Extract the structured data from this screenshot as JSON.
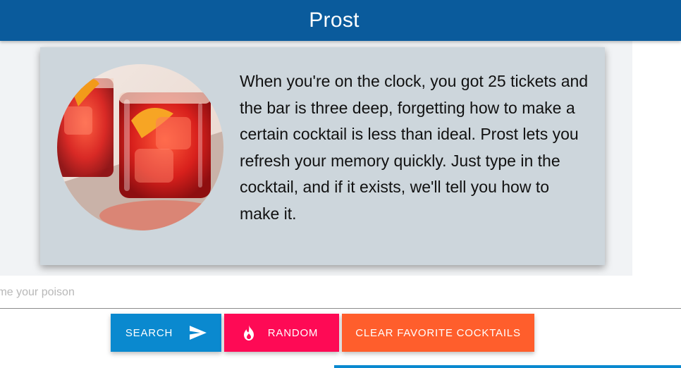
{
  "app": {
    "title": "Prost",
    "colors": {
      "appbar": "#0a5b9c",
      "card": "#cdd6dc",
      "search_button": "#0a89cf",
      "random_button": "#fe0a55",
      "clear_button": "#ff5e2c"
    }
  },
  "hero": {
    "image_icon": "cocktail-photo",
    "text": "When you're on the clock, you got 25 tickets and the bar is three deep, forgetting how to make a certain cocktail is less than ideal. Prost lets you refresh your memory quickly. Just type in the cocktail, and if it exists, we'll tell you how to make it."
  },
  "search": {
    "placeholder": "Name your poison",
    "value": ""
  },
  "actions": {
    "search": {
      "label": "SEARCH",
      "icon": "send-icon"
    },
    "random": {
      "label": "RANDOM",
      "icon": "fire-icon"
    },
    "clear": {
      "label": "CLEAR FAVORITE COCKTAILS"
    }
  }
}
